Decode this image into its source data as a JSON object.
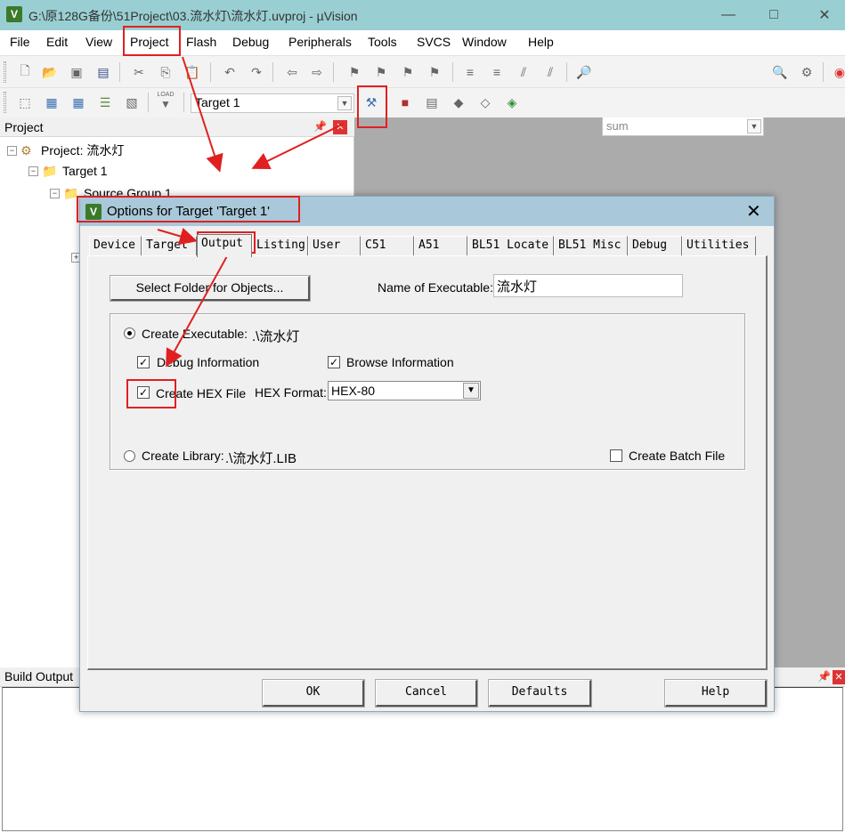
{
  "window": {
    "title": "G:\\原128G备份\\51Project\\03.流水灯\\流水灯.uvproj - µVision",
    "app_icon_text": "V"
  },
  "menubar": [
    "File",
    "Edit",
    "View",
    "Project",
    "Flash",
    "Debug",
    "Peripherals",
    "Tools",
    "SVCS",
    "Window",
    "Help"
  ],
  "toolbar": {
    "find_combo_value": "sum",
    "target_combo_value": "Target 1",
    "load_label": "LOAD"
  },
  "project_panel": {
    "header": "Project",
    "tree": [
      {
        "label": "Project: 流水灯",
        "toggle": "−"
      },
      {
        "label": "Target 1",
        "toggle": "−"
      },
      {
        "label": "Source Group 1",
        "toggle": "−"
      }
    ]
  },
  "build_output": {
    "header": "Build Output"
  },
  "dialog": {
    "title": "Options for Target 'Target 1'",
    "icon_text": "V",
    "tabs": [
      "Device",
      "Target",
      "Output",
      "Listing",
      "User",
      "C51",
      "A51",
      "BL51 Locate",
      "BL51 Misc",
      "Debug",
      "Utilities"
    ],
    "active_tab": "Output",
    "select_folder_label": "Select Folder for Objects...",
    "name_exe_label": "Name of Executable:",
    "name_exe_value": "流水灯",
    "create_executable_label": "Create Executable:",
    "create_executable_path": ".\\流水灯",
    "debug_info_label": "Debug Information",
    "browse_info_label": "Browse Information",
    "create_hex_label": "Create HEX File",
    "hex_format_label": "HEX Format:",
    "hex_format_value": "HEX-80",
    "create_library_label": "Create Library:",
    "create_library_path": ".\\流水灯.LIB",
    "create_batch_label": "Create Batch File",
    "ok_label": "OK",
    "cancel_label": "Cancel",
    "defaults_label": "Defaults",
    "help_label": "Help",
    "states": {
      "create_executable": true,
      "debug_info": true,
      "browse_info": true,
      "create_hex": true,
      "create_library": false,
      "create_batch": false
    }
  },
  "annotation_color": "#e02020"
}
